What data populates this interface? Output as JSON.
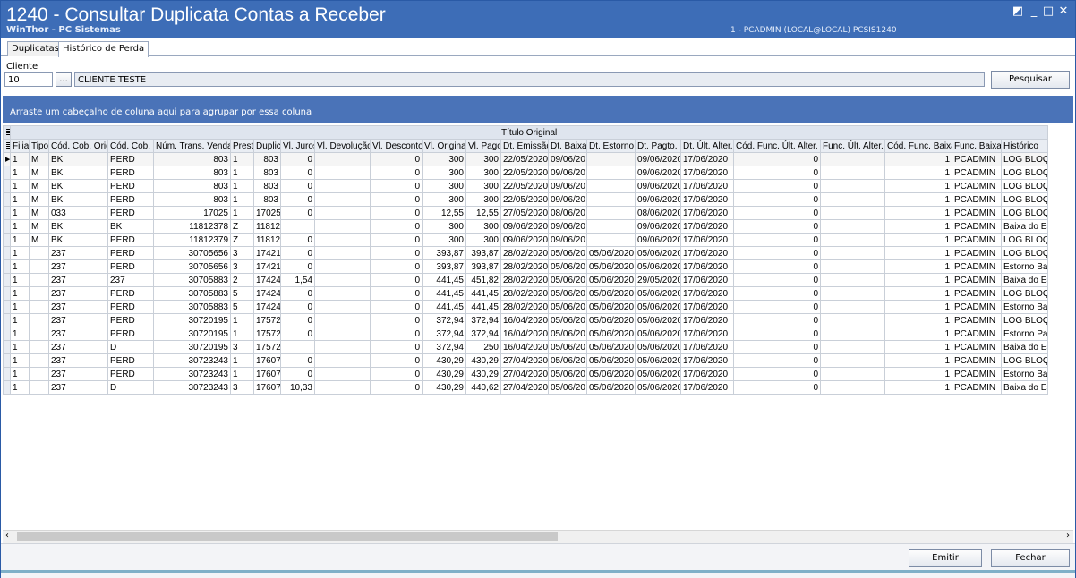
{
  "window": {
    "title": "1240 - Consultar Duplicata Contas a Receber",
    "subtitle": "WinThor - PC Sistemas",
    "user_info": "1 - PCADMIN (LOCAL@LOCAL)   PCSIS1240",
    "controls": {
      "restore": "◩",
      "minimize": "_",
      "maximize": "□",
      "close": "✕"
    }
  },
  "tabs": [
    {
      "label": "Duplicatas"
    },
    {
      "label": "Histórico de Perda"
    }
  ],
  "filter": {
    "label": "Cliente",
    "client_code": "10",
    "lookup_label": "...",
    "client_name": "CLIENTE TESTE",
    "search_label": "Pesquisar"
  },
  "group_hint": "Arraste um cabeçalho de coluna aqui para agrupar por essa coluna",
  "grid": {
    "band_label": "Título Original",
    "columns": [
      "Filial",
      "Tipo",
      "Cód. Cob. Orig.",
      "Cód. Cob.",
      "Núm. Trans. Venda.",
      "Prest",
      "Duplic",
      "Vl. Juros",
      "Vl. Devolução",
      "Vl. Desconto",
      "Vl. Original",
      "Vl. Pago",
      "Dt. Emissão",
      "Dt. Baixa",
      "Dt. Estorno",
      "Dt. Pagto.",
      "Dt. Últ. Alter.",
      "Cód. Func. Últ. Alter.",
      "Func. Últ. Alter.",
      "Cód. Func. Baixa",
      "Func. Baixa",
      "Histórico"
    ],
    "rows": [
      [
        "1",
        "M",
        "BK",
        "PERD",
        "803",
        "1",
        "803",
        "0",
        "",
        "0",
        "300",
        "300",
        "22/05/2020",
        "09/06/20",
        "",
        "09/06/2020",
        "17/06/2020",
        "0",
        "",
        "1",
        "PCADMIN",
        "LOG BLOQ."
      ],
      [
        "1",
        "M",
        "BK",
        "PERD",
        "803",
        "1",
        "803",
        "0",
        "",
        "0",
        "300",
        "300",
        "22/05/2020",
        "09/06/20",
        "",
        "09/06/2020",
        "17/06/2020",
        "0",
        "",
        "1",
        "PCADMIN",
        "LOG BLOQ."
      ],
      [
        "1",
        "M",
        "BK",
        "PERD",
        "803",
        "1",
        "803",
        "0",
        "",
        "0",
        "300",
        "300",
        "22/05/2020",
        "09/06/20",
        "",
        "09/06/2020",
        "17/06/2020",
        "0",
        "",
        "1",
        "PCADMIN",
        "LOG BLOQ."
      ],
      [
        "1",
        "M",
        "BK",
        "PERD",
        "803",
        "1",
        "803",
        "0",
        "",
        "0",
        "300",
        "300",
        "22/05/2020",
        "09/06/20",
        "",
        "09/06/2020",
        "17/06/2020",
        "0",
        "",
        "1",
        "PCADMIN",
        "LOG BLOQ."
      ],
      [
        "1",
        "M",
        "033",
        "PERD",
        "17025",
        "1",
        "17025",
        "0",
        "",
        "0",
        "12,55",
        "12,55",
        "27/05/2020",
        "08/06/20",
        "",
        "08/06/2020",
        "17/06/2020",
        "0",
        "",
        "1",
        "PCADMIN",
        "LOG BLOQ."
      ],
      [
        "1",
        "M",
        "BK",
        "BK",
        "11812378",
        "Z",
        "11812",
        "",
        "",
        "0",
        "300",
        "300",
        "09/06/2020",
        "09/06/20",
        "",
        "09/06/2020",
        "17/06/2020",
        "0",
        "",
        "1",
        "PCADMIN",
        "Baixa do Es"
      ],
      [
        "1",
        "M",
        "BK",
        "PERD",
        "11812379",
        "Z",
        "11812",
        "0",
        "",
        "0",
        "300",
        "300",
        "09/06/2020",
        "09/06/20",
        "",
        "09/06/2020",
        "17/06/2020",
        "0",
        "",
        "1",
        "PCADMIN",
        "LOG BLOQ."
      ],
      [
        "1",
        "",
        "237",
        "PERD",
        "30705656",
        "3",
        "17421",
        "0",
        "",
        "0",
        "393,87",
        "393,87",
        "28/02/2020",
        "05/06/20",
        "05/06/2020",
        "05/06/2020",
        "17/06/2020",
        "0",
        "",
        "1",
        "PCADMIN",
        "LOG BLOQ."
      ],
      [
        "1",
        "",
        "237",
        "PERD",
        "30705656",
        "3",
        "17421",
        "0",
        "",
        "0",
        "393,87",
        "393,87",
        "28/02/2020",
        "05/06/20",
        "05/06/2020",
        "05/06/2020",
        "17/06/2020",
        "0",
        "",
        "1",
        "PCADMIN",
        "Estorno Bai"
      ],
      [
        "1",
        "",
        "237",
        "237",
        "30705883",
        "2",
        "17424",
        "1,54",
        "",
        "0",
        "441,45",
        "451,82",
        "28/02/2020",
        "05/06/20",
        "05/06/2020",
        "29/05/2020",
        "17/06/2020",
        "0",
        "",
        "1",
        "PCADMIN",
        "Baixa do Es"
      ],
      [
        "1",
        "",
        "237",
        "PERD",
        "30705883",
        "5",
        "17424",
        "0",
        "",
        "0",
        "441,45",
        "441,45",
        "28/02/2020",
        "05/06/20",
        "05/06/2020",
        "05/06/2020",
        "17/06/2020",
        "0",
        "",
        "1",
        "PCADMIN",
        "LOG BLOQ."
      ],
      [
        "1",
        "",
        "237",
        "PERD",
        "30705883",
        "5",
        "17424",
        "0",
        "",
        "0",
        "441,45",
        "441,45",
        "28/02/2020",
        "05/06/20",
        "05/06/2020",
        "05/06/2020",
        "17/06/2020",
        "0",
        "",
        "1",
        "PCADMIN",
        "Estorno Bai"
      ],
      [
        "1",
        "",
        "237",
        "PERD",
        "30720195",
        "1",
        "17572",
        "0",
        "",
        "0",
        "372,94",
        "372,94",
        "16/04/2020",
        "05/06/20",
        "05/06/2020",
        "05/06/2020",
        "17/06/2020",
        "0",
        "",
        "1",
        "PCADMIN",
        "LOG BLOQ."
      ],
      [
        "1",
        "",
        "237",
        "PERD",
        "30720195",
        "1",
        "17572",
        "0",
        "",
        "0",
        "372,94",
        "372,94",
        "16/04/2020",
        "05/06/20",
        "05/06/2020",
        "05/06/2020",
        "17/06/2020",
        "0",
        "",
        "1",
        "PCADMIN",
        "Estorno Par"
      ],
      [
        "1",
        "",
        "237",
        "D",
        "30720195",
        "3",
        "17572",
        "",
        "",
        "0",
        "372,94",
        "250",
        "16/04/2020",
        "05/06/20",
        "05/06/2020",
        "05/06/2020",
        "17/06/2020",
        "0",
        "",
        "1",
        "PCADMIN",
        "Baixa do Es"
      ],
      [
        "1",
        "",
        "237",
        "PERD",
        "30723243",
        "1",
        "17607",
        "0",
        "",
        "0",
        "430,29",
        "430,29",
        "27/04/2020",
        "05/06/20",
        "05/06/2020",
        "05/06/2020",
        "17/06/2020",
        "0",
        "",
        "1",
        "PCADMIN",
        "LOG BLOQ."
      ],
      [
        "1",
        "",
        "237",
        "PERD",
        "30723243",
        "1",
        "17607",
        "0",
        "",
        "0",
        "430,29",
        "430,29",
        "27/04/2020",
        "05/06/20",
        "05/06/2020",
        "05/06/2020",
        "17/06/2020",
        "0",
        "",
        "1",
        "PCADMIN",
        "Estorno Bai"
      ],
      [
        "1",
        "",
        "237",
        "D",
        "30723243",
        "3",
        "17607",
        "10,33",
        "",
        "0",
        "430,29",
        "440,62",
        "27/04/2020",
        "05/06/20",
        "05/06/2020",
        "05/06/2020",
        "17/06/2020",
        "0",
        "",
        "1",
        "PCADMIN",
        "Baixa do Es"
      ]
    ]
  },
  "footer": {
    "emit_label": "Emitir",
    "close_label": "Fechar"
  }
}
